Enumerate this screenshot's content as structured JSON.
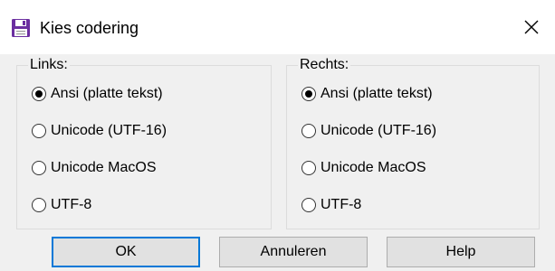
{
  "window": {
    "title": "Kies codering",
    "close_glyph": "✕",
    "app_icon": "floppy-disk-icon"
  },
  "groups": {
    "left": {
      "label": "Links:",
      "options": [
        {
          "label": "Ansi (platte tekst)",
          "checked": true
        },
        {
          "label": "Unicode (UTF-16)",
          "checked": false
        },
        {
          "label": "Unicode MacOS",
          "checked": false
        },
        {
          "label": "UTF-8",
          "checked": false
        }
      ]
    },
    "right": {
      "label": "Rechts:",
      "options": [
        {
          "label": "Ansi (platte tekst)",
          "checked": true
        },
        {
          "label": "Unicode (UTF-16)",
          "checked": false
        },
        {
          "label": "Unicode MacOS",
          "checked": false
        },
        {
          "label": "UTF-8",
          "checked": false
        }
      ]
    }
  },
  "buttons": {
    "ok": "OK",
    "cancel": "Annuleren",
    "help": "Help"
  },
  "colors": {
    "default_button_border": "#0078d7",
    "icon_purple": "#6b2fa0"
  }
}
